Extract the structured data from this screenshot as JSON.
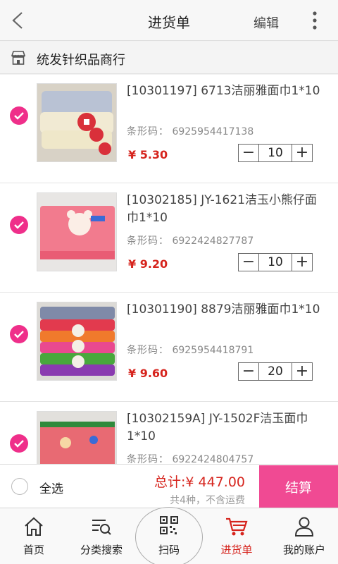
{
  "header": {
    "title": "进货单",
    "edit_label": "编辑"
  },
  "shop": {
    "name": "统发针织品商行"
  },
  "items": [
    {
      "name": "[10301197] 6713洁丽雅面巾1*10",
      "barcode_label": "条形码：",
      "barcode": "6925954417138",
      "price": "¥ 5.30",
      "qty": "10",
      "checked": true
    },
    {
      "name": "[10302185] JY-1621洁玉小熊仔面巾1*10",
      "barcode_label": "条形码：",
      "barcode": "6922424827787",
      "price": "¥ 9.20",
      "qty": "10",
      "checked": true
    },
    {
      "name": "[10301190] 8879洁丽雅面巾1*10",
      "barcode_label": "条形码：",
      "barcode": "6925954418791",
      "price": "¥ 9.60",
      "qty": "20",
      "checked": true
    },
    {
      "name": "[10302159A] JY-1502F洁玉面巾1*10",
      "barcode_label": "条形码：",
      "barcode": "6922424804757",
      "price": "",
      "qty": "",
      "checked": true
    }
  ],
  "footer": {
    "select_all_label": "全选",
    "total": "总计:¥ 447.00",
    "summary": "共4种，不含运费",
    "checkout_label": "结算"
  },
  "tabs": [
    {
      "label": "首页",
      "icon": "home-icon"
    },
    {
      "label": "分类搜索",
      "icon": "category-search-icon"
    },
    {
      "label": "扫码",
      "icon": "qr-scan-icon"
    },
    {
      "label": "进货单",
      "icon": "cart-icon",
      "active": true
    },
    {
      "label": "我的账户",
      "icon": "user-icon"
    }
  ],
  "colors": {
    "accent_pink": "#ef2f8a",
    "checkout_pink": "#f04a93",
    "price_red": "#d6241d"
  }
}
